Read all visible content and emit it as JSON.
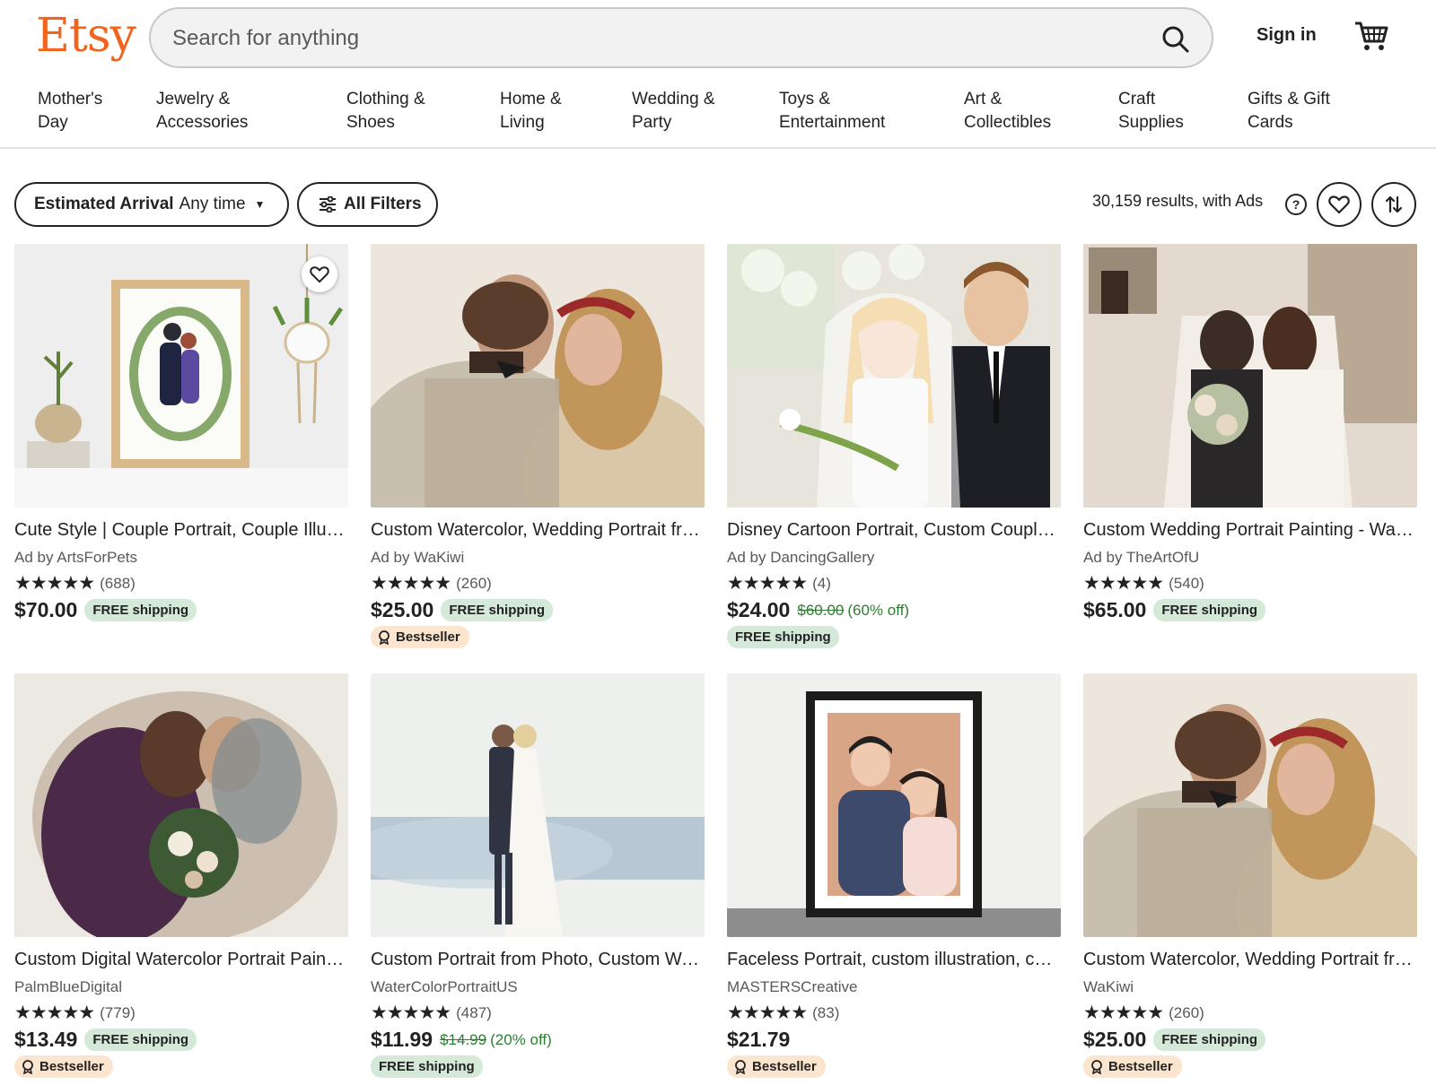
{
  "brand": {
    "logo": "Etsy",
    "color": "#F1641E"
  },
  "search": {
    "placeholder": "Search for anything",
    "icon": "search-icon"
  },
  "header": {
    "signin": "Sign in",
    "cart_icon": "cart-icon"
  },
  "categories": [
    {
      "l1": "Mother's",
      "l2": "Day"
    },
    {
      "l1": "Jewelry &",
      "l2": "Accessories"
    },
    {
      "l1": "Clothing &",
      "l2": "Shoes"
    },
    {
      "l1": "Home &",
      "l2": "Living"
    },
    {
      "l1": "Wedding &",
      "l2": "Party"
    },
    {
      "l1": "Toys &",
      "l2": "Entertainment"
    },
    {
      "l1": "Art &",
      "l2": "Collectibles"
    },
    {
      "l1": "Craft",
      "l2": "Supplies"
    },
    {
      "l1": "Gifts & Gift",
      "l2": "Cards"
    }
  ],
  "filters": {
    "arrival_label": "Estimated Arrival",
    "arrival_value": "Any time",
    "all_filters": "All Filters",
    "results": "30,159 results, with Ads",
    "help": "?"
  },
  "listings": [
    {
      "title": "Cute Style | Couple Portrait, Couple Illustration",
      "shop": "Ad by ArtsForPets",
      "stars": "★★★★★",
      "reviews": "(688)",
      "price": "$70.00",
      "original": "",
      "discount": "",
      "shipping": "FREE shipping",
      "badge": ""
    },
    {
      "title": "Custom Watercolor, Wedding Portrait from Photo",
      "shop": "Ad by WaKiwi",
      "stars": "★★★★★",
      "reviews": "(260)",
      "price": "$25.00",
      "original": "",
      "discount": "",
      "shipping": "FREE shipping",
      "badge": "Bestseller"
    },
    {
      "title": "Disney Cartoon Portrait, Custom Couple Portrait",
      "shop": "Ad by DancingGallery",
      "stars": "★★★★★",
      "reviews": "(4)",
      "price": "$24.00",
      "original": "$60.00",
      "discount": "(60% off)",
      "shipping": "FREE shipping",
      "badge": ""
    },
    {
      "title": "Custom Wedding Portrait Painting - Watercolor",
      "shop": "Ad by TheArtOfU",
      "stars": "★★★★★",
      "reviews": "(540)",
      "price": "$65.00",
      "original": "",
      "discount": "",
      "shipping": "FREE shipping",
      "badge": ""
    },
    {
      "title": "Custom Digital Watercolor Portrait Painting",
      "shop": "PalmBlueDigital",
      "stars": "★★★★★",
      "reviews": "(779)",
      "price": "$13.49",
      "original": "",
      "discount": "",
      "shipping": "FREE shipping",
      "badge": "Bestseller"
    },
    {
      "title": "Custom Portrait from Photo, Custom Watercolor",
      "shop": "WaterColorPortraitUS",
      "stars": "★★★★★",
      "reviews": "(487)",
      "price": "$11.99",
      "original": "$14.99",
      "discount": "(20% off)",
      "shipping": "FREE shipping",
      "badge": ""
    },
    {
      "title": "Faceless Portrait, custom illustration, couple",
      "shop": "MASTERSCreative",
      "stars": "★★★★★",
      "reviews": "(83)",
      "price": "$21.79",
      "original": "",
      "discount": "",
      "shipping": "",
      "badge": "Bestseller"
    },
    {
      "title": "Custom Watercolor, Wedding Portrait from Photo",
      "shop": "WaKiwi",
      "stars": "★★★★★",
      "reviews": "(260)",
      "price": "$25.00",
      "original": "",
      "discount": "",
      "shipping": "FREE shipping",
      "badge": "Bestseller"
    }
  ]
}
